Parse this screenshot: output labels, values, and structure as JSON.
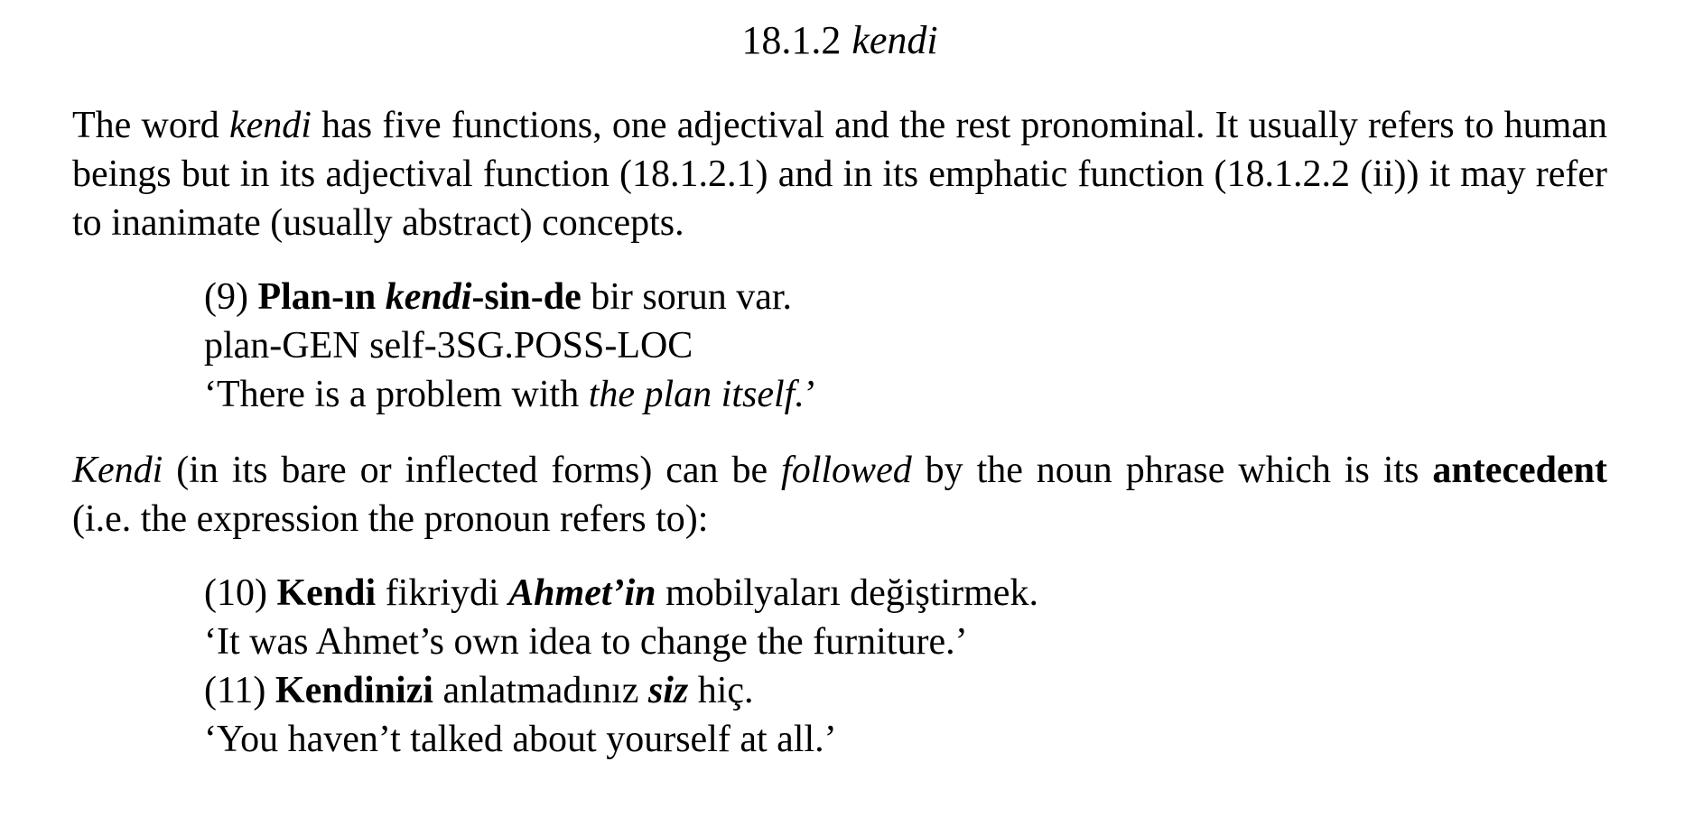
{
  "heading": {
    "number": "18.1.2",
    "title": "kendi"
  },
  "para1": {
    "t1": "The word ",
    "t2": "kendi",
    "t3": " has five functions, one adjectival and the rest pronominal. It usually refers to human beings but in its adjectival function (18.1.2.1) and in its emphatic function (18.1.2.2 (ii)) it may refer to inanimate (usually abstract) concepts."
  },
  "ex9": {
    "num": "(9) ",
    "w1": "Plan-ın ",
    "w2": "kendi",
    "w3": "-sin-de",
    "w4": " bir sorun var.",
    "gloss": "plan-GEN self-3SG.POSS-LOC",
    "tr1": "‘There is a problem with ",
    "tr2": "the plan itself.",
    "tr3": "’"
  },
  "para2": {
    "t1": "Kendi",
    "t2": " (in its bare or inflected forms) can be ",
    "t3": "followed",
    "t4": " by the noun phrase which is its ",
    "t5": "antecedent",
    "t6": " (i.e. the expression the pronoun refers to):"
  },
  "ex10": {
    "num": "(10) ",
    "w1": "Kendi",
    "w2": " fikriydi ",
    "w3": "Ahmet’in",
    "w4": " mobilyaları değiştirmek.",
    "tr": "‘It was Ahmet’s own idea to change the furniture.’"
  },
  "ex11": {
    "num": "(11) ",
    "w1": "Kendinizi",
    "w2": " anlatmadınız ",
    "w3": "siz",
    "w4": " hiç.",
    "tr": "‘You haven’t talked about yourself at all.’"
  }
}
